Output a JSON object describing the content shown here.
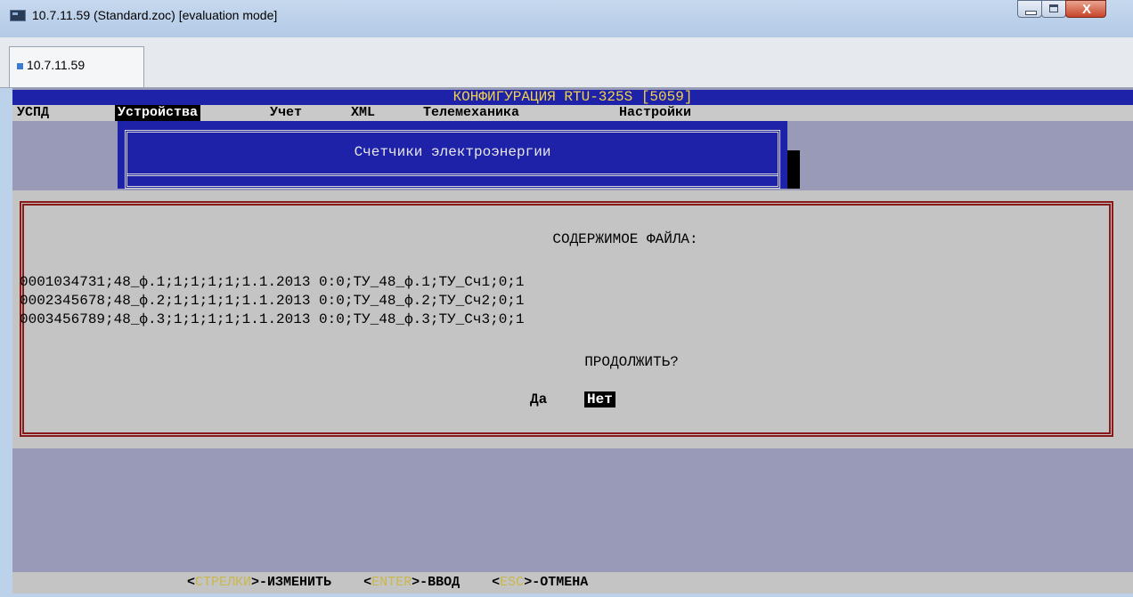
{
  "window": {
    "title": "10.7.11.59 (Standard.zoc) [evaluation mode]",
    "close_glyph": "X"
  },
  "tabs": [
    {
      "label": "10.7.11.59",
      "active": true
    }
  ],
  "terminal": {
    "header_title": "КОНФИГУРАЦИЯ RTU-325S [5059]",
    "menu": [
      {
        "label": "УСПД",
        "selected": false
      },
      {
        "label": "Устройства",
        "selected": true
      },
      {
        "label": "Учет",
        "selected": false
      },
      {
        "label": "XML",
        "selected": false
      },
      {
        "label": "Телемеханика",
        "selected": false
      },
      {
        "label": "Настройки",
        "selected": false
      }
    ],
    "background_window_title": "Счетчики электроэнергии",
    "dialog": {
      "heading": "СОДЕРЖИМОЕ ФАЙЛА:",
      "lines": [
        "0001034731;48_ф.1;1;1;1;1;1.1.2013 0:0;ТУ_48_ф.1;ТУ_Сч1;0;1",
        "0002345678;48_ф.2;1;1;1;1;1.1.2013 0:0;ТУ_48_ф.2;ТУ_Сч2;0;1",
        "0003456789;48_ф.3;1;1;1;1;1.1.2013 0:0;ТУ_48_ф.3;ТУ_Сч3;0;1"
      ],
      "prompt": "ПРОДОЛЖИТЬ?",
      "yes_label": "Да",
      "no_label": "Нет",
      "selected": "Нет"
    },
    "status_bar": {
      "hints": [
        {
          "key": "СТРЕЛКИ",
          "action": "-ИЗМЕНИТЬ"
        },
        {
          "key": "ENTER",
          "action": "-ВВОД"
        },
        {
          "key": "ESC",
          "action": "-ОТМЕНА"
        }
      ]
    }
  },
  "colors": {
    "terminal_bg": "#9999b8",
    "header_bg": "#1e22a8",
    "header_text": "#f0d34a",
    "dialog_bg": "#c4c4c4",
    "dialog_border": "#8a1a1a",
    "key_highlight": "#c9b84b"
  }
}
